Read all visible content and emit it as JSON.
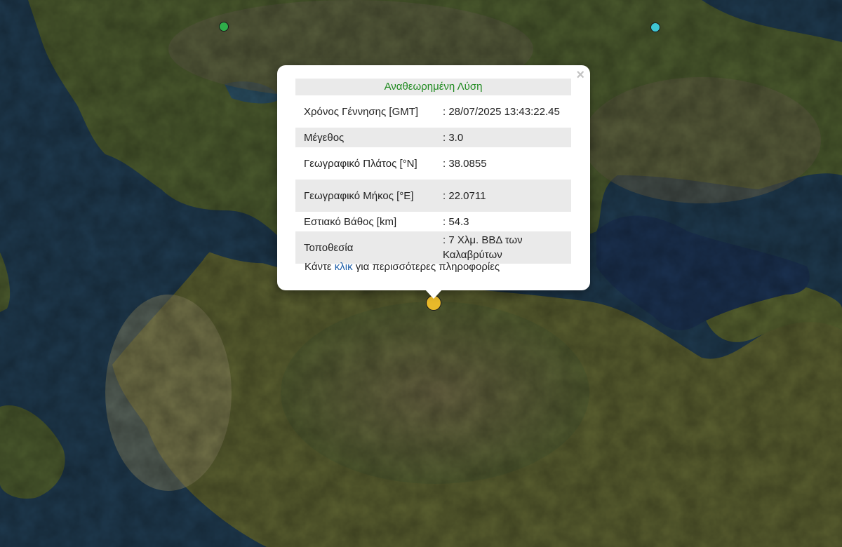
{
  "popup": {
    "title": "Αναθεωρημένη Λύση",
    "close_label": "×",
    "rows": [
      {
        "label": "Χρόνος Γέννησης [GMT]",
        "value": ": 28/07/2025 13:43:22.45"
      },
      {
        "label": "Μέγεθος",
        "value": ": 3.0"
      },
      {
        "label": "Γεωγραφικό Πλάτος [°N]",
        "value": ": 38.0855"
      },
      {
        "label": "Γεωγραφικό Μήκος [°E]",
        "value": ": 22.0711"
      },
      {
        "label": "Εστιακό Βάθος [km]",
        "value": ": 54.3"
      },
      {
        "label": "Τοποθεσία",
        "value": ": 7 Χλμ. ΒΒΔ των Καλαβρύτων"
      }
    ],
    "more_prefix": "Κάντε",
    "more_link": "κλικ",
    "more_suffix": "για περισσότερες πληροφορίες"
  },
  "markers": [
    {
      "name": "selected-earthquake",
      "color": "#e8b92a"
    },
    {
      "name": "earthquake-green",
      "color": "#2fae4a"
    },
    {
      "name": "earthquake-cyan",
      "color": "#3fc6d3"
    }
  ],
  "colors": {
    "land": "#4f5a2e",
    "sea": "#1f3a4f",
    "heading_text": "#1f8a1f",
    "link": "#1f5fa8"
  }
}
